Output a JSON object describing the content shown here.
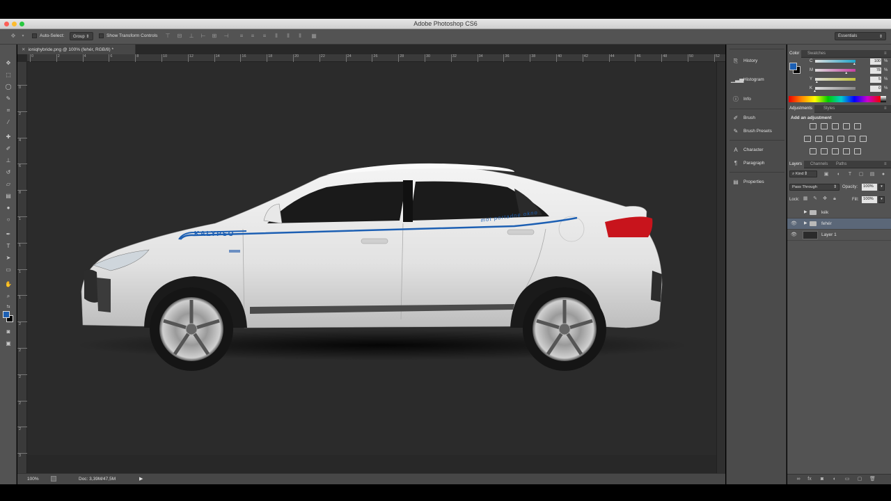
{
  "window": {
    "title": "Adobe Photoshop CS6"
  },
  "options_bar": {
    "auto_select_label": "Auto-Select:",
    "auto_select_value": "Group",
    "transform_controls_label": "Show Transform Controls",
    "workspace": "Essentials"
  },
  "document": {
    "tab_title": "ioniqhybride.png @ 100% (fehér, RGB/8) *",
    "ruler_top": [
      "0",
      "2",
      "4",
      "6",
      "8",
      "10",
      "12",
      "14",
      "16",
      "18",
      "20",
      "22",
      "24",
      "26",
      "28",
      "30",
      "32",
      "34",
      "36",
      "38",
      "40",
      "42",
      "44",
      "46",
      "48",
      "50",
      "52"
    ],
    "ruler_left": [
      "0",
      "2",
      "4",
      "6",
      "8",
      "1",
      "1",
      "1",
      "1",
      "2",
      "2",
      "2",
      "2",
      "2",
      "3",
      "3"
    ],
    "logo_text": "KALYPSO",
    "slogan_text": "mot portadne okno"
  },
  "status": {
    "zoom": "100%",
    "doc_size": "Doc: 3,39M/47,5M"
  },
  "dock": {
    "items": [
      "History",
      "Histogram",
      "Info",
      "Brush",
      "Brush Presets",
      "Character",
      "Paragraph",
      "Properties"
    ]
  },
  "color_panel": {
    "tabs": [
      "Color",
      "Swatches"
    ],
    "sliders": [
      {
        "label": "C",
        "value": "100",
        "pos": 0.98,
        "color": "#1fa5c9"
      },
      {
        "label": "M",
        "value": "78",
        "pos": 0.78,
        "color": "#c63fa0"
      },
      {
        "label": "Y",
        "value": "5",
        "pos": 0.05,
        "color": "#c4c43a"
      },
      {
        "label": "K",
        "value": "0",
        "pos": 0.0,
        "color": "#888888"
      }
    ],
    "pct": "%",
    "fg_color": "#1c5fb3",
    "bg_color": "#000000"
  },
  "adjustments": {
    "tabs": [
      "Adjustments",
      "Styles"
    ],
    "title": "Add an adjustment"
  },
  "layers": {
    "tabs": [
      "Layers",
      "Channels",
      "Paths"
    ],
    "filter_label": "Kind",
    "blend_mode": "Pass Through",
    "opacity_label": "Opacity:",
    "opacity_value": "100%",
    "lock_label": "Lock:",
    "fill_label": "Fill:",
    "fill_value": "100%",
    "rows": [
      {
        "name": "kék",
        "type": "group",
        "visible": false,
        "selected": false
      },
      {
        "name": "fehér",
        "type": "group",
        "visible": true,
        "selected": true
      },
      {
        "name": "Layer 1",
        "type": "layer",
        "visible": true,
        "selected": false
      }
    ]
  }
}
